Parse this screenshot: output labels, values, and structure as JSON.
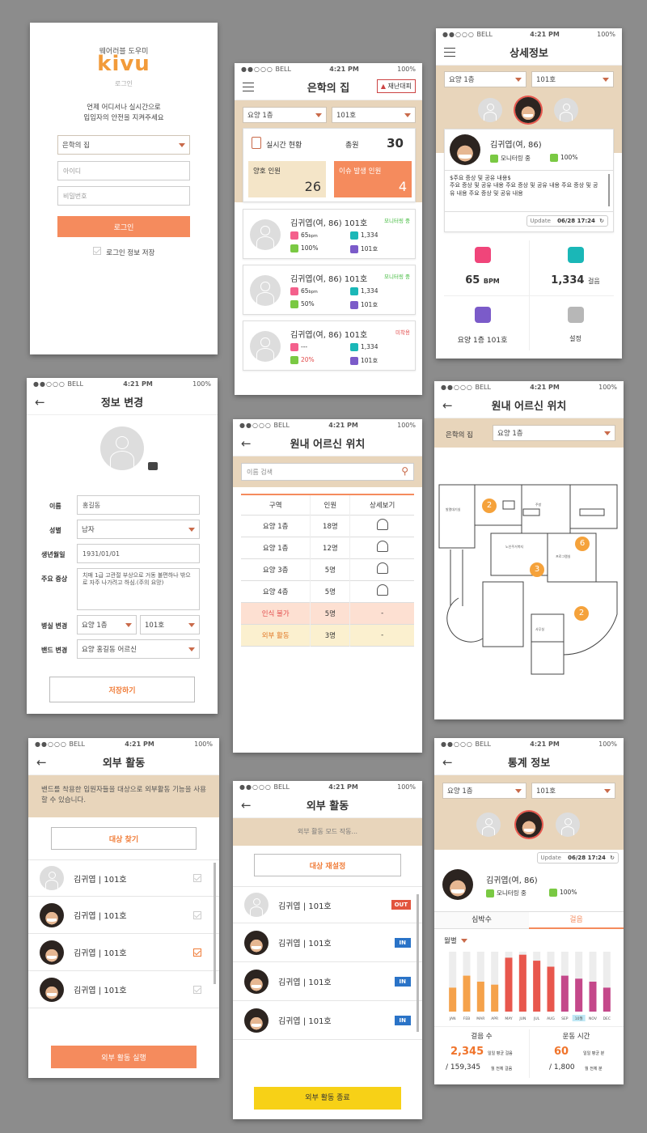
{
  "status": {
    "carrier": "BELL",
    "time": "4:21 PM",
    "battery": "100%"
  },
  "login": {
    "subtitle": "웨어러블 도우미",
    "logo": "kivu",
    "heading": "로그인",
    "desc1": "언제 어디서나 실시간으로",
    "desc2": "입임자의 안전을 지켜주세요",
    "facility": "은학의 집",
    "id_placeholder": "아이디",
    "pw_placeholder": "비밀번호",
    "button": "로그인",
    "save_label": "로그인 정보 저장"
  },
  "home": {
    "title": "은학의 집",
    "evac_button": "재난대피",
    "floor": "요양 1층",
    "room": "101호",
    "realtime_label": "실시간 현황",
    "total_label": "총원",
    "total": "30",
    "good_label": "양호 인원",
    "good": "26",
    "issue_label": "이슈 발생 인원",
    "issue": "4",
    "residents": [
      {
        "name": "김귀엽(여, 86) 101호",
        "status": "모니터링 중",
        "bpm": "65",
        "bpm_unit": "bpm",
        "steps": "1,334",
        "battery": "100%",
        "room": "101호"
      },
      {
        "name": "김귀엽(여, 86) 101호",
        "status": "모니터링 중",
        "bpm": "65",
        "bpm_unit": "bpm",
        "steps": "1,334",
        "battery": "50%",
        "room": "101호"
      },
      {
        "name": "김귀엽(여, 86) 101호",
        "status": "미착용",
        "bpm": "---",
        "bpm_unit": "",
        "steps": "1,334",
        "battery": "20%",
        "room": "101호"
      }
    ]
  },
  "detail": {
    "title": "상세정보",
    "floor": "요양 1층",
    "room": "101호",
    "name": "김귀엽(여, 86)",
    "monitor": "모니터링 중",
    "battery": "100%",
    "note_title": "$주요 증상 및 공유 내용$",
    "note_body": "주요 증상 및 공유 내용 주요 증상 및 공유 내용 주요 증상 및 공유 내용 주요 증상 및 공유 내용",
    "update_label": "Update",
    "update_time": "06/28 17:24",
    "bpm": "65",
    "bpm_unit": "BPM",
    "steps": "1,334",
    "steps_unit": "걸음",
    "location": "요양 1층 101호",
    "settings": "설정"
  },
  "edit": {
    "title": "정보 변경",
    "labels": {
      "name": "이름",
      "gender": "성별",
      "birth": "생년월일",
      "symptom": "주요 증상",
      "room": "병실 변경",
      "band": "밴드 변경"
    },
    "name": "홍길동",
    "gender": "남자",
    "birth": "1931/01/01",
    "symptom": "치매 1급 고관절 부상으로 거동 불편하나 밖으로 자주 나가려고 하심.(주의 요망)",
    "floor": "요양 1층",
    "room": "101호",
    "band": "요양 홍길동 어르신",
    "save": "저장하기"
  },
  "locationList": {
    "title": "원내 어르신 위치",
    "search_placeholder": "이름 검색",
    "headers": [
      "구역",
      "인원",
      "상세보기"
    ],
    "rows": [
      {
        "zone": "요양 1층",
        "count": "18명",
        "detail": ""
      },
      {
        "zone": "요양 1층",
        "count": "12명",
        "detail": ""
      },
      {
        "zone": "요양 3층",
        "count": "5명",
        "detail": ""
      },
      {
        "zone": "요양 4층",
        "count": "5명",
        "detail": ""
      },
      {
        "zone": "인식 불가",
        "count": "5명",
        "detail": "-"
      },
      {
        "zone": "외부 활동",
        "count": "3명",
        "detail": "-"
      }
    ]
  },
  "floorMap": {
    "title": "원내 어르신 위치",
    "facility": "은학의 집",
    "floor": "요양 1층",
    "markers": [
      "2",
      "3",
      "6",
      "2"
    ],
    "rooms": [
      "발열대기실",
      "주방",
      "노인주거복지",
      "프로그램실",
      "사무실"
    ]
  },
  "outdoor": {
    "title": "외부 활동",
    "notice": "밴드를 착용한 입원자들을 대상으로 외부활동 기능을 사용할 수 있습니다.",
    "find": "대상 찾기",
    "people": [
      {
        "name": "김귀엽",
        "room": "101호"
      },
      {
        "name": "김귀엽",
        "room": "101호"
      },
      {
        "name": "김귀엽",
        "room": "101호"
      },
      {
        "name": "김귀엽",
        "room": "101호"
      }
    ],
    "run": "외부 활동 실행"
  },
  "outdoorActive": {
    "title": "외부 활동",
    "mode": "외부 활동 모드 작동...",
    "reset": "대상 재설정",
    "people": [
      {
        "name": "김귀엽",
        "room": "101호",
        "state": "OUT"
      },
      {
        "name": "김귀엽",
        "room": "101호",
        "state": "IN"
      },
      {
        "name": "김귀엽",
        "room": "101호",
        "state": "IN"
      },
      {
        "name": "김귀엽",
        "room": "101호",
        "state": "IN"
      }
    ],
    "end": "외부 활동 종료"
  },
  "stats": {
    "title": "통계 정보",
    "floor": "요양 1층",
    "room": "101호",
    "update_label": "Update",
    "update_time": "06/28 17:24",
    "name": "김귀엽(여, 86)",
    "monitor": "모니터링 중",
    "battery": "100%",
    "tabs": [
      "심박수",
      "걸음"
    ],
    "period": "월별",
    "steps_label": "걸음 수",
    "steps_avg": "2,345",
    "steps_avg_note": "일일 평균 걸음",
    "steps_total": "/ 159,345",
    "steps_total_note": "월 전체 걸음",
    "exercise_label": "운동 시간",
    "exercise_avg": "60",
    "exercise_avg_note": "일일 평균 분",
    "exercise_total": "/ 1,800",
    "exercise_total_note": "월 전체 분"
  },
  "chart_data": {
    "type": "bar",
    "categories": [
      "JAN",
      "FEB",
      "MAR",
      "APR",
      "MAY",
      "JUN",
      "JUL",
      "AUG",
      "SEP",
      "10월",
      "NOV",
      "DEC"
    ],
    "values": [
      40,
      60,
      50,
      45,
      90,
      95,
      85,
      75,
      60,
      55,
      50,
      40
    ],
    "ylim": [
      0,
      100
    ],
    "selected_category": "10월",
    "colors": [
      "#f5a24b",
      "#f5a24b",
      "#f5a24b",
      "#f5a24b",
      "#e8574d",
      "#e8574d",
      "#e8574d",
      "#e8574d",
      "#c4488a",
      "#c4488a",
      "#c4488a",
      "#c4488a"
    ]
  }
}
